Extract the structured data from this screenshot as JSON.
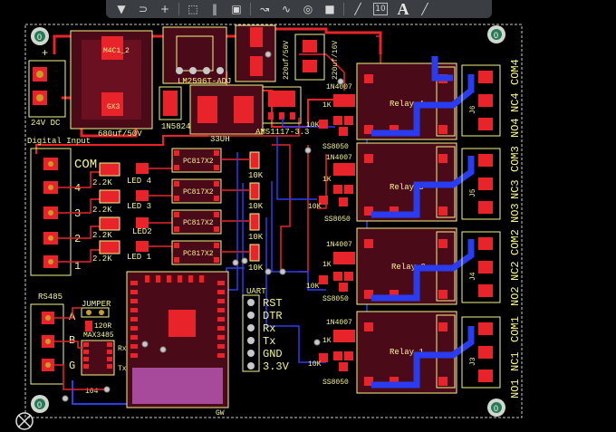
{
  "toolbar": {
    "tools": [
      {
        "name": "filter-tool",
        "glyph": "▼"
      },
      {
        "name": "route-tool",
        "glyph": "⊃"
      },
      {
        "name": "place-tool",
        "glyph": "+"
      },
      {
        "name": "select-rect-tool",
        "glyph": "⬚"
      },
      {
        "name": "chart-tool",
        "glyph": "‖"
      },
      {
        "name": "component-tool",
        "glyph": "▣"
      },
      {
        "name": "interactive-route-tool",
        "glyph": "↝"
      },
      {
        "name": "diff-pair-tool",
        "glyph": "∿"
      },
      {
        "name": "via-tool",
        "glyph": "◎"
      },
      {
        "name": "fill-tool",
        "glyph": "■"
      },
      {
        "name": "line-tool",
        "glyph": "╱"
      },
      {
        "name": "string-tool",
        "glyph": "10"
      },
      {
        "name": "text-tool",
        "glyph": "A"
      },
      {
        "name": "draw-line-tool",
        "glyph": "╱"
      }
    ]
  },
  "silk": {
    "power_in": "24V DC",
    "plus": "+",
    "fuse": "M4C1_2",
    "gnd_pad": "GX3",
    "cap_main": "680uf/50V",
    "regulator": "LM2596T-ADJ",
    "cap1": "220uf/50V",
    "cap2": "220uf/16V",
    "diode": "1N5824",
    "inductor": "33UH",
    "ldo": "AMS1117-3.3",
    "digital_input": "Digital Input",
    "com": "COM",
    "in4": "4",
    "in3": "3",
    "in2": "2",
    "in1": "1",
    "res_in": "2.2K",
    "led4": "LED 4",
    "led3": "LED 3",
    "led2": "LED2",
    "led1": "LED 1",
    "opto": "PC817X2",
    "res10k": "10K",
    "res1k": "1K",
    "diode_rel": "1N4007",
    "transistor": "SS8050",
    "relay4": "Relay 4",
    "relay3": "Relay 3",
    "relay2": "Relay 2",
    "relay1": "Relay 1",
    "j6": "J6",
    "j5": "J5",
    "j4": "J4",
    "j3": "J3",
    "com4": "COM4",
    "nc4": "NC4",
    "no4": "NO4",
    "com3": "COM3",
    "nc3": "NC3",
    "no3": "NO3",
    "com2": "COM2",
    "nc2": "NC2",
    "no2": "NO2",
    "com1": "COM1",
    "nc1": "NC1",
    "no1": "NO1",
    "rs485": "RS485",
    "jumper": "JUMPER",
    "res120": "120R",
    "max": "MAX3485",
    "a": "A",
    "b": "B",
    "g": "G",
    "rx": "Rx",
    "tx": "Tx",
    "cap104": "104",
    "uart": "UART",
    "rst": "RST",
    "dtr": "DTR",
    "urx": "Rx",
    "utx": "Tx",
    "gnd": "GND",
    "v33": "3.3V",
    "mcu": "GW"
  }
}
